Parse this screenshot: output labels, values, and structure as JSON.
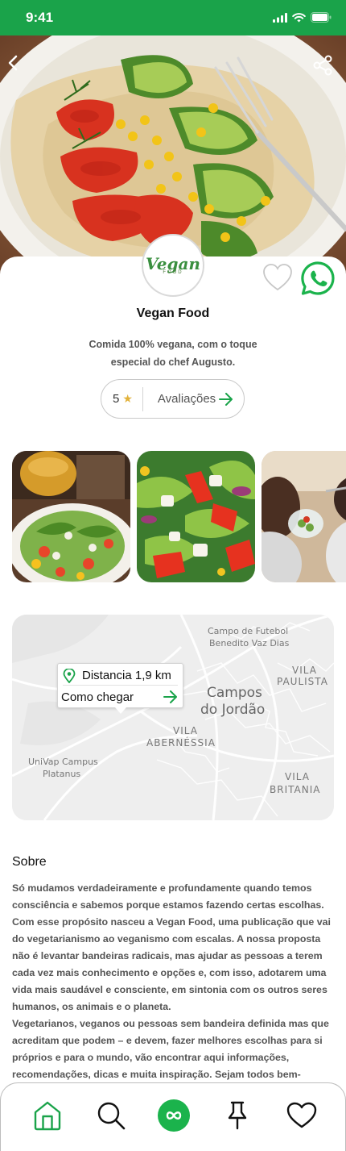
{
  "status_bar": {
    "time": "9:41"
  },
  "colors": {
    "brand": "#1aa34a",
    "whatsapp": "#1bb34c",
    "star": "#e2b23a",
    "accent_arrow": "#1aa34a"
  },
  "store": {
    "logo_word": "Vegan",
    "logo_sub": "FOOD",
    "name": "Vegan Food",
    "description": "Comida 100% vegana, com o toque especial do chef Augusto."
  },
  "rating": {
    "value": "5",
    "star": "★",
    "reviews_label": "Avaliações"
  },
  "gallery": {
    "photos": [
      "salad-plate",
      "salad-close-up",
      "people-eating"
    ]
  },
  "map": {
    "labels": {
      "stadium": "Campo de Futebol",
      "stadium2": "Benedito Vaz Dias",
      "vila_paulista1": "VILA",
      "vila_paulista2": "PAULISTA",
      "city1": "Campos",
      "city2": "do Jordão",
      "abernessia1": "VILA",
      "abernessia2": "ABERNÉSSIA",
      "univap1": "UniVap Campus",
      "univap2": "Platanus",
      "britania1": "VILA",
      "britania2": "BRITANIA"
    },
    "distance_label": "Distancia 1,9 km",
    "directions_label": "Como chegar"
  },
  "about": {
    "title": "Sobre",
    "paragraph1": "Só mudamos verdadeiramente e profundamente quando temos consciência e sabemos porque estamos fazendo certas escolhas. Com esse propósito nasceu a Vegan Food, uma publicação que vai do vegetarianismo ao veganismo com escalas. A nossa proposta não é levantar bandeiras radicais, mas ajudar as pessoas a terem cada vez mais conhecimento e opções e, com isso, adotarem uma vida mais saudável e consciente, em sintonia com os outros seres humanos, os animais e o planeta.",
    "paragraph2": "Vegetarianos, veganos ou pessoas sem bandeira definida mas que acreditam que podem – e devem, fazer melhores escolhas para si próprios e para o mundo, vão encontrar aqui informações, recomendações, dicas e muita inspiração. Sejam todos bem-vindos."
  },
  "tabbar": {
    "items": [
      "home-icon",
      "search-icon",
      "infinity-icon",
      "pin-icon",
      "heart-icon"
    ]
  }
}
